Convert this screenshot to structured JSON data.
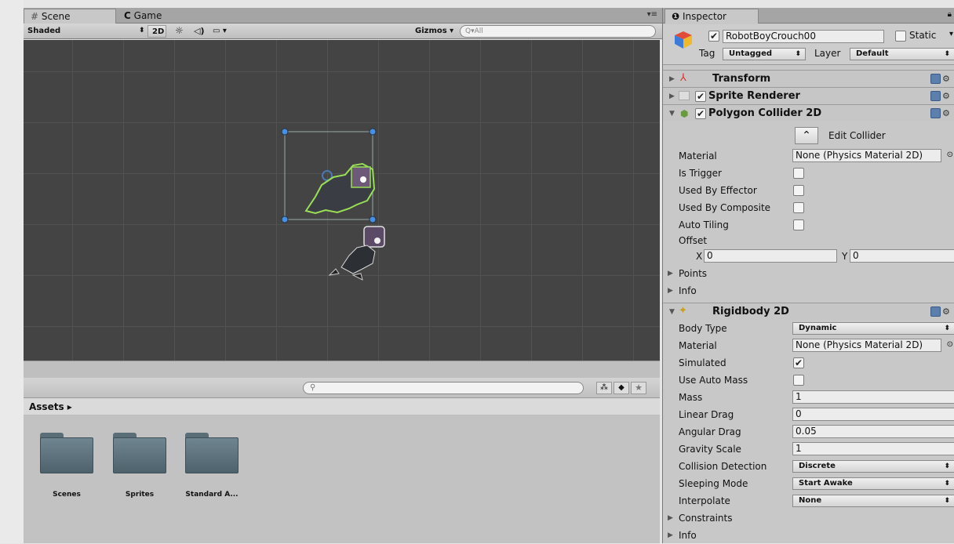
{
  "tabs": {
    "scene": "Scene",
    "game": "Game",
    "menu": "▾≡"
  },
  "scene_toolbar": {
    "shading": "Shaded",
    "mode_2d": "2D",
    "gizmos": "Gizmos",
    "search_placeholder": "Q▾All"
  },
  "project": {
    "breadcrumb": "Assets ▸",
    "folders": [
      "Scenes",
      "Sprites",
      "Standard A..."
    ]
  },
  "inspector": {
    "tab": "Inspector",
    "object_name": "RobotBoyCrouch00",
    "static_label": "Static",
    "tag_label": "Tag",
    "tag_value": "Untagged",
    "layer_label": "Layer",
    "layer_value": "Default",
    "transform": "Transform",
    "sprite_renderer": "Sprite Renderer",
    "polygon_collider": {
      "title": "Polygon Collider 2D",
      "edit_collider": "Edit Collider",
      "material_label": "Material",
      "material_value": "None (Physics Material 2D)",
      "is_trigger": "Is Trigger",
      "used_by_effector": "Used By Effector",
      "used_by_composite": "Used By Composite",
      "auto_tiling": "Auto Tiling",
      "offset": "Offset",
      "offset_x_label": "X",
      "offset_x": "0",
      "offset_y_label": "Y",
      "offset_y": "0",
      "points": "Points",
      "info": "Info"
    },
    "rigidbody": {
      "title": "Rigidbody 2D",
      "body_type_label": "Body Type",
      "body_type": "Dynamic",
      "material_label": "Material",
      "material_value": "None (Physics Material 2D)",
      "simulated": "Simulated",
      "use_auto_mass": "Use Auto Mass",
      "mass_label": "Mass",
      "mass": "1",
      "linear_drag_label": "Linear Drag",
      "linear_drag": "0",
      "angular_drag_label": "Angular Drag",
      "angular_drag": "0.05",
      "gravity_scale_label": "Gravity Scale",
      "gravity_scale": "1",
      "collision_detection_label": "Collision Detection",
      "collision_detection": "Discrete",
      "sleeping_mode_label": "Sleeping Mode",
      "sleeping_mode": "Start Awake",
      "interpolate_label": "Interpolate",
      "interpolate": "None",
      "constraints": "Constraints",
      "info": "Info"
    }
  }
}
